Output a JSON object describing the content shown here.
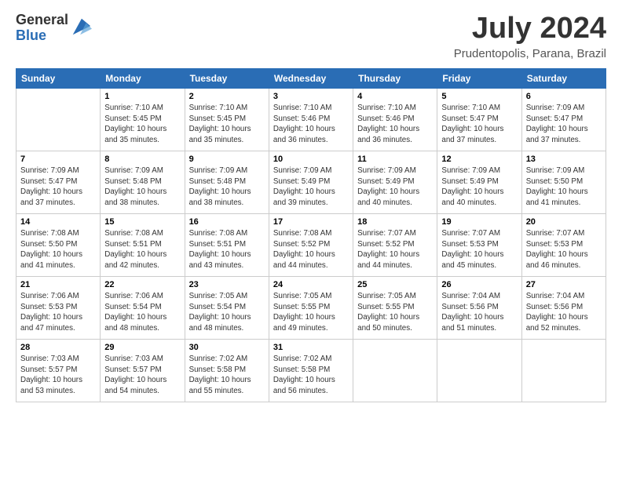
{
  "header": {
    "logo_general": "General",
    "logo_blue": "Blue",
    "month_year": "July 2024",
    "location": "Prudentopolis, Parana, Brazil"
  },
  "weekdays": [
    "Sunday",
    "Monday",
    "Tuesday",
    "Wednesday",
    "Thursday",
    "Friday",
    "Saturday"
  ],
  "weeks": [
    [
      {
        "day": "",
        "info": ""
      },
      {
        "day": "1",
        "info": "Sunrise: 7:10 AM\nSunset: 5:45 PM\nDaylight: 10 hours\nand 35 minutes."
      },
      {
        "day": "2",
        "info": "Sunrise: 7:10 AM\nSunset: 5:45 PM\nDaylight: 10 hours\nand 35 minutes."
      },
      {
        "day": "3",
        "info": "Sunrise: 7:10 AM\nSunset: 5:46 PM\nDaylight: 10 hours\nand 36 minutes."
      },
      {
        "day": "4",
        "info": "Sunrise: 7:10 AM\nSunset: 5:46 PM\nDaylight: 10 hours\nand 36 minutes."
      },
      {
        "day": "5",
        "info": "Sunrise: 7:10 AM\nSunset: 5:47 PM\nDaylight: 10 hours\nand 37 minutes."
      },
      {
        "day": "6",
        "info": "Sunrise: 7:09 AM\nSunset: 5:47 PM\nDaylight: 10 hours\nand 37 minutes."
      }
    ],
    [
      {
        "day": "7",
        "info": "Sunrise: 7:09 AM\nSunset: 5:47 PM\nDaylight: 10 hours\nand 37 minutes."
      },
      {
        "day": "8",
        "info": "Sunrise: 7:09 AM\nSunset: 5:48 PM\nDaylight: 10 hours\nand 38 minutes."
      },
      {
        "day": "9",
        "info": "Sunrise: 7:09 AM\nSunset: 5:48 PM\nDaylight: 10 hours\nand 38 minutes."
      },
      {
        "day": "10",
        "info": "Sunrise: 7:09 AM\nSunset: 5:49 PM\nDaylight: 10 hours\nand 39 minutes."
      },
      {
        "day": "11",
        "info": "Sunrise: 7:09 AM\nSunset: 5:49 PM\nDaylight: 10 hours\nand 40 minutes."
      },
      {
        "day": "12",
        "info": "Sunrise: 7:09 AM\nSunset: 5:49 PM\nDaylight: 10 hours\nand 40 minutes."
      },
      {
        "day": "13",
        "info": "Sunrise: 7:09 AM\nSunset: 5:50 PM\nDaylight: 10 hours\nand 41 minutes."
      }
    ],
    [
      {
        "day": "14",
        "info": "Sunrise: 7:08 AM\nSunset: 5:50 PM\nDaylight: 10 hours\nand 41 minutes."
      },
      {
        "day": "15",
        "info": "Sunrise: 7:08 AM\nSunset: 5:51 PM\nDaylight: 10 hours\nand 42 minutes."
      },
      {
        "day": "16",
        "info": "Sunrise: 7:08 AM\nSunset: 5:51 PM\nDaylight: 10 hours\nand 43 minutes."
      },
      {
        "day": "17",
        "info": "Sunrise: 7:08 AM\nSunset: 5:52 PM\nDaylight: 10 hours\nand 44 minutes."
      },
      {
        "day": "18",
        "info": "Sunrise: 7:07 AM\nSunset: 5:52 PM\nDaylight: 10 hours\nand 44 minutes."
      },
      {
        "day": "19",
        "info": "Sunrise: 7:07 AM\nSunset: 5:53 PM\nDaylight: 10 hours\nand 45 minutes."
      },
      {
        "day": "20",
        "info": "Sunrise: 7:07 AM\nSunset: 5:53 PM\nDaylight: 10 hours\nand 46 minutes."
      }
    ],
    [
      {
        "day": "21",
        "info": "Sunrise: 7:06 AM\nSunset: 5:53 PM\nDaylight: 10 hours\nand 47 minutes."
      },
      {
        "day": "22",
        "info": "Sunrise: 7:06 AM\nSunset: 5:54 PM\nDaylight: 10 hours\nand 48 minutes."
      },
      {
        "day": "23",
        "info": "Sunrise: 7:05 AM\nSunset: 5:54 PM\nDaylight: 10 hours\nand 48 minutes."
      },
      {
        "day": "24",
        "info": "Sunrise: 7:05 AM\nSunset: 5:55 PM\nDaylight: 10 hours\nand 49 minutes."
      },
      {
        "day": "25",
        "info": "Sunrise: 7:05 AM\nSunset: 5:55 PM\nDaylight: 10 hours\nand 50 minutes."
      },
      {
        "day": "26",
        "info": "Sunrise: 7:04 AM\nSunset: 5:56 PM\nDaylight: 10 hours\nand 51 minutes."
      },
      {
        "day": "27",
        "info": "Sunrise: 7:04 AM\nSunset: 5:56 PM\nDaylight: 10 hours\nand 52 minutes."
      }
    ],
    [
      {
        "day": "28",
        "info": "Sunrise: 7:03 AM\nSunset: 5:57 PM\nDaylight: 10 hours\nand 53 minutes."
      },
      {
        "day": "29",
        "info": "Sunrise: 7:03 AM\nSunset: 5:57 PM\nDaylight: 10 hours\nand 54 minutes."
      },
      {
        "day": "30",
        "info": "Sunrise: 7:02 AM\nSunset: 5:58 PM\nDaylight: 10 hours\nand 55 minutes."
      },
      {
        "day": "31",
        "info": "Sunrise: 7:02 AM\nSunset: 5:58 PM\nDaylight: 10 hours\nand 56 minutes."
      },
      {
        "day": "",
        "info": ""
      },
      {
        "day": "",
        "info": ""
      },
      {
        "day": "",
        "info": ""
      }
    ]
  ]
}
